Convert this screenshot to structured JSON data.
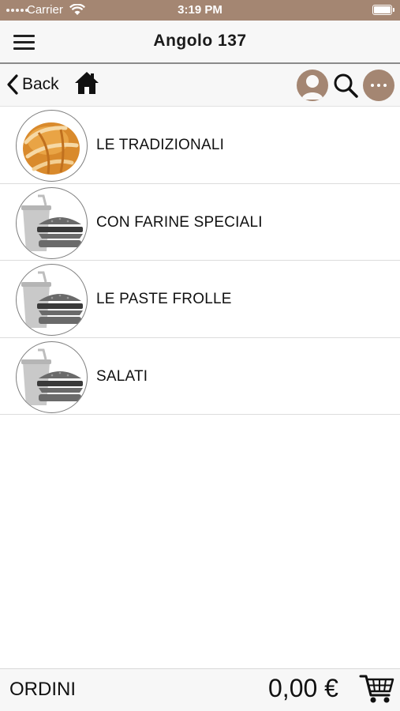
{
  "status": {
    "carrier": "Carrier",
    "time": "3:19 PM",
    "bg_color": "#a48672"
  },
  "header": {
    "title": "Angolo 137",
    "menu_icon": "hamburger-icon"
  },
  "toolbar": {
    "back_label": "Back",
    "icons": [
      "chevron-left-icon",
      "home-icon",
      "user-icon",
      "search-icon",
      "more-icon"
    ],
    "accent_color": "#a48672"
  },
  "categories": [
    {
      "label": "LE TRADIZIONALI",
      "image": "croissant"
    },
    {
      "label": "CON FARINE SPECIALI",
      "image": "placeholder-drink-burger"
    },
    {
      "label": "LE PASTE FROLLE",
      "image": "placeholder-drink-burger"
    },
    {
      "label": "SALATI",
      "image": "placeholder-drink-burger"
    }
  ],
  "footer": {
    "orders_label": "ORDINI",
    "total": "0,00 €",
    "cart_icon": "cart-icon"
  }
}
